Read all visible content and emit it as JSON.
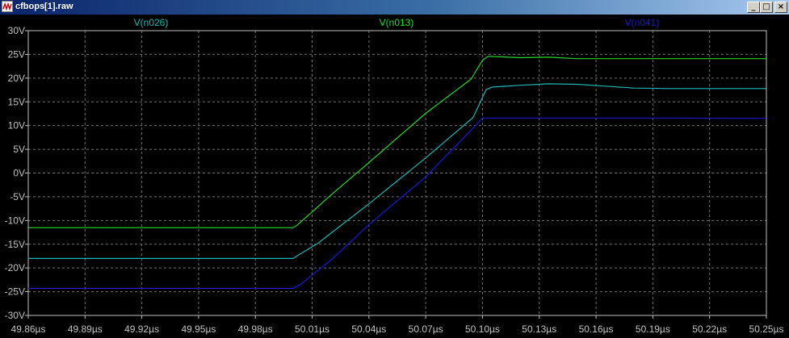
{
  "window": {
    "title": "cfbops[1].raw",
    "buttons": {
      "minimize": "_",
      "maximize": "□",
      "close": "×"
    }
  },
  "colors": {
    "background": "#000000",
    "grid": "#6f6f6f",
    "axis_text": "#c0c0c0",
    "V(n026)": "#1fb5b5",
    "V(n013)": "#29d62b",
    "V(n041)": "#1a1acd"
  },
  "chart_data": {
    "type": "line",
    "title": "",
    "xlabel": "",
    "ylabel": "",
    "grid": true,
    "legend_placement": "top",
    "xlim": [
      49.86,
      50.25
    ],
    "ylim": [
      -30,
      30
    ],
    "x_ticks": [
      "49.86µs",
      "49.89µs",
      "49.92µs",
      "49.95µs",
      "49.98µs",
      "50.01µs",
      "50.04µs",
      "50.07µs",
      "50.10µs",
      "50.13µs",
      "50.16µs",
      "50.19µs",
      "50.22µs",
      "50.25µs"
    ],
    "y_ticks": [
      "30V",
      "25V",
      "20V",
      "15V",
      "10V",
      "5V",
      "0V",
      "-5V",
      "-10V",
      "-15V",
      "-20V",
      "-25V",
      "-30V"
    ],
    "series": [
      {
        "name": "V(n026)",
        "color": "#1fb5b5",
        "points": [
          [
            49.86,
            -18.0
          ],
          [
            49.9,
            -18.0
          ],
          [
            49.95,
            -18.0
          ],
          [
            50.0,
            -18.0
          ],
          [
            50.003,
            -17.2
          ],
          [
            50.013,
            -14.8
          ],
          [
            50.04,
            -6.5
          ],
          [
            50.07,
            3.2
          ],
          [
            50.095,
            11.7
          ],
          [
            50.102,
            17.6
          ],
          [
            50.105,
            18.1
          ],
          [
            50.12,
            18.5
          ],
          [
            50.135,
            18.8
          ],
          [
            50.15,
            18.7
          ],
          [
            50.165,
            18.3
          ],
          [
            50.18,
            17.9
          ],
          [
            50.2,
            17.8
          ],
          [
            50.25,
            17.8
          ]
        ]
      },
      {
        "name": "V(n013)",
        "color": "#29d62b",
        "points": [
          [
            49.86,
            -11.5
          ],
          [
            49.9,
            -11.5
          ],
          [
            49.95,
            -11.5
          ],
          [
            50.0,
            -11.5
          ],
          [
            50.002,
            -11.0
          ],
          [
            50.004,
            -10.3
          ],
          [
            50.02,
            -4.6
          ],
          [
            50.04,
            2.2
          ],
          [
            50.07,
            12.6
          ],
          [
            50.094,
            19.8
          ],
          [
            50.1,
            23.8
          ],
          [
            50.103,
            24.6
          ],
          [
            50.12,
            24.3
          ],
          [
            50.135,
            24.4
          ],
          [
            50.15,
            24.1
          ],
          [
            50.18,
            24.1
          ],
          [
            50.25,
            24.1
          ]
        ]
      },
      {
        "name": "V(n041)",
        "color": "#1a1acd",
        "points": [
          [
            49.86,
            -24.3
          ],
          [
            49.9,
            -24.3
          ],
          [
            49.95,
            -24.3
          ],
          [
            50.0,
            -24.3
          ],
          [
            50.004,
            -23.4
          ],
          [
            50.02,
            -18.3
          ],
          [
            50.04,
            -10.9
          ],
          [
            50.07,
            -0.8
          ],
          [
            50.097,
            10.3
          ],
          [
            50.1,
            11.6
          ],
          [
            50.13,
            11.6
          ],
          [
            50.2,
            11.6
          ],
          [
            50.25,
            11.5
          ]
        ]
      }
    ]
  }
}
